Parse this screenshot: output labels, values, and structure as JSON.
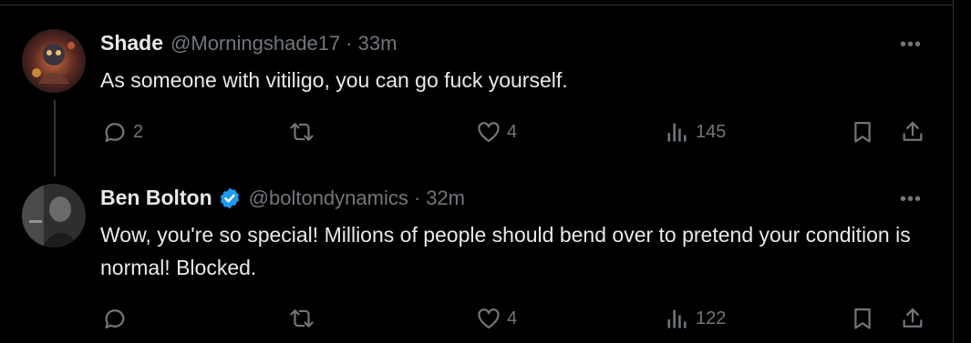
{
  "tweets": [
    {
      "name": "Shade",
      "handle": "@Morningshade17",
      "separator": "·",
      "time": "33m",
      "text": "As someone with vitiligo, you can go fuck yourself.",
      "verified": false,
      "more": "•••",
      "reply_count": "2",
      "retweet_count": "",
      "like_count": "4",
      "view_count": "145"
    },
    {
      "name": "Ben Bolton",
      "handle": "@boltondynamics",
      "separator": "·",
      "time": "32m",
      "text": "Wow, you're so special! Millions of people should bend over to pretend your condition is normal! Blocked.",
      "verified": true,
      "more": "•••",
      "reply_count": "",
      "retweet_count": "",
      "like_count": "4",
      "view_count": "122"
    }
  ],
  "colors": {
    "background": "#000000",
    "text": "#e7e9ea",
    "muted": "#71767b",
    "verified": "#1d9bf0",
    "border": "#2f3336"
  }
}
